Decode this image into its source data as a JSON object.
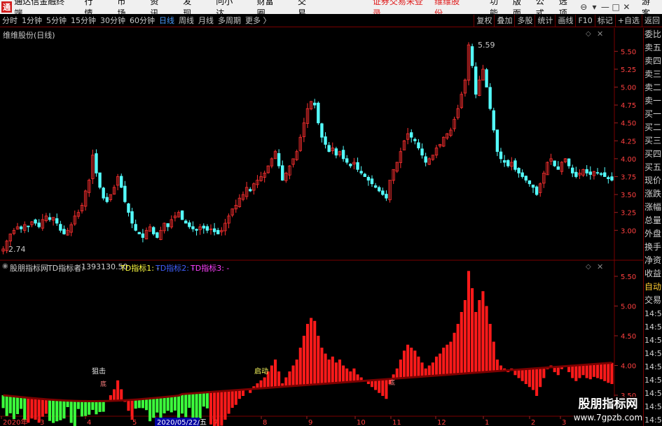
{
  "titlebar": {
    "logo": "通",
    "app_title": "通达信金融终端",
    "menus": [
      "行情",
      "市场",
      "资讯",
      "发现",
      "问小达",
      "财富圈",
      "交易"
    ],
    "notice": "证券交易未登录",
    "stock_name": "维维股份",
    "right_menus": [
      "功能",
      "版面",
      "公式",
      "选项"
    ],
    "window_controls": [
      "⊖",
      "▾",
      "—",
      "□",
      "✕"
    ],
    "guest": "游客"
  },
  "toolbar": {
    "periods": [
      "分时",
      "1分钟",
      "5分钟",
      "15分钟",
      "30分钟",
      "60分钟",
      "日线",
      "周线",
      "月线",
      "多周期",
      "更多 〉"
    ],
    "active_period": "日线",
    "right_buttons": [
      "复权",
      "叠加",
      "多股",
      "统计",
      "画线",
      "F10",
      "标记",
      "+自选",
      "返回"
    ]
  },
  "main_chart": {
    "title": "维维股份(日线)",
    "high_label": "5.59",
    "low_label": "2.74",
    "y_ticks": [
      "5.50",
      "5.25",
      "5.00",
      "4.75",
      "4.50",
      "4.25",
      "4.00",
      "3.75",
      "3.50",
      "3.25",
      "3.00"
    ],
    "colors": {
      "up": "#ff3030",
      "down": "#54ffff",
      "bg": "#000000",
      "grid": "#7a0000"
    }
  },
  "indicator": {
    "name": "股朋指标网",
    "td_name": "TD指标者:",
    "td_value": "1393130.50",
    "td1": "TD指标1: -",
    "td2": "TD指标2: -",
    "td3": "TD指标3: -",
    "y_ticks": [
      "5.50",
      "5.00",
      "4.50",
      "4.00",
      "3.50"
    ],
    "annotations": [
      "狙击",
      "底",
      "启动",
      "底"
    ],
    "colors": {
      "red": "#ff1a1a",
      "green": "#3cff3c",
      "blue": "#4060ff",
      "magenta": "#ff40ff",
      "yellow": "#ffff40"
    }
  },
  "x_axis": {
    "labels": [
      "2020年",
      "3",
      "4",
      "5",
      "2020/05/22/五",
      "7",
      "8",
      "9",
      "10",
      "11",
      "12",
      "1",
      "2",
      "3"
    ]
  },
  "right_panel": {
    "labels": [
      "委比",
      "卖五",
      "卖四",
      "卖三",
      "卖二",
      "卖一",
      "买一",
      "买二",
      "买三",
      "买四",
      "买五",
      "现价",
      "涨跌",
      "涨幅",
      "总量",
      "外盘",
      "换手",
      "净资",
      "收益",
      "自动",
      "交易"
    ],
    "times": [
      "14:56",
      "14:56",
      "14:56",
      "14:56",
      "14:56",
      "14:56",
      "14:56",
      "14:56",
      "14:56"
    ]
  },
  "watermark": {
    "line1": "股朋指标网",
    "line2": "www.7gpzb.com"
  },
  "chart_data": {
    "type": "candlestick",
    "title": "维维股份(日线)",
    "ylim": [
      2.7,
      5.65
    ],
    "close_prices": [
      2.74,
      2.85,
      2.95,
      3.0,
      3.05,
      3.02,
      3.08,
      3.05,
      3.12,
      3.1,
      3.05,
      3.15,
      3.2,
      3.15,
      3.18,
      3.1,
      3.0,
      2.95,
      3.0,
      3.08,
      3.2,
      3.25,
      3.35,
      3.55,
      3.7,
      4.05,
      3.8,
      3.6,
      3.45,
      3.4,
      3.5,
      3.6,
      3.75,
      3.6,
      3.4,
      3.25,
      3.1,
      3.0,
      2.95,
      2.9,
      3.0,
      3.05,
      2.95,
      2.9,
      3.0,
      3.1,
      3.05,
      3.15,
      3.2,
      3.25,
      3.15,
      3.1,
      3.05,
      3.02,
      3.0,
      3.05,
      3.03,
      3.0,
      3.02,
      2.98,
      2.95,
      3.0,
      3.1,
      3.2,
      3.3,
      3.35,
      3.45,
      3.5,
      3.6,
      3.55,
      3.65,
      3.7,
      3.75,
      3.8,
      3.9,
      4.0,
      4.1,
      3.9,
      3.7,
      3.8,
      3.9,
      4.0,
      4.1,
      4.3,
      4.5,
      4.7,
      4.8,
      4.75,
      4.5,
      4.3,
      4.2,
      4.1,
      4.15,
      4.05,
      4.1,
      4.0,
      3.95,
      3.9,
      3.95,
      3.85,
      3.8,
      3.75,
      3.7,
      3.65,
      3.6,
      3.55,
      3.5,
      3.45,
      3.7,
      3.85,
      3.95,
      4.1,
      4.25,
      4.35,
      4.3,
      4.25,
      4.15,
      4.05,
      3.95,
      4.0,
      4.05,
      4.15,
      4.2,
      4.3,
      4.35,
      4.4,
      4.55,
      4.7,
      4.9,
      5.1,
      5.59,
      5.3,
      4.9,
      5.1,
      5.25,
      5.0,
      4.7,
      4.4,
      4.1,
      4.0,
      3.95,
      3.9,
      3.95,
      3.85,
      3.8,
      3.75,
      3.7,
      3.65,
      3.6,
      3.5,
      3.65,
      3.8,
      3.95,
      4.0,
      3.9,
      3.85,
      3.95,
      4.0,
      3.9,
      3.8,
      3.75,
      3.8,
      3.85,
      3.8,
      3.78,
      3.82,
      3.8,
      3.78,
      3.75,
      3.72,
      3.7
    ]
  }
}
